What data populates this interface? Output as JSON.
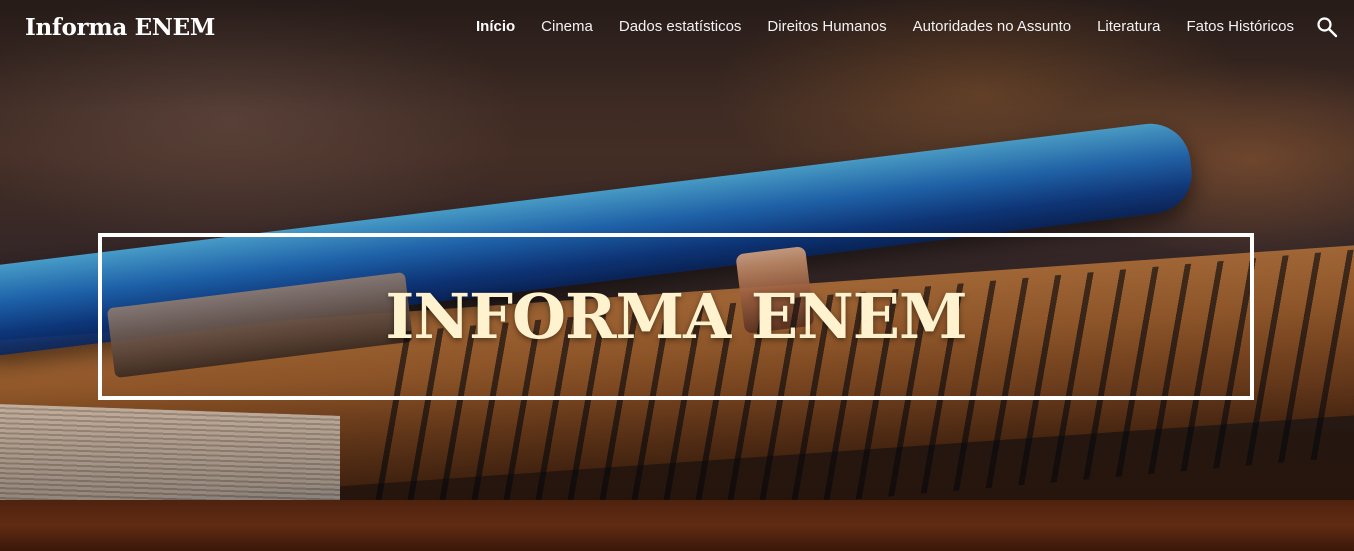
{
  "site": {
    "title": "Informa ENEM"
  },
  "nav": {
    "items": [
      {
        "label": "Início",
        "active": true
      },
      {
        "label": "Cinema",
        "active": false
      },
      {
        "label": "Dados estatísticos",
        "active": false
      },
      {
        "label": "Direitos Humanos",
        "active": false
      },
      {
        "label": "Autoridades no Assunto",
        "active": false
      },
      {
        "label": "Literatura",
        "active": false
      },
      {
        "label": "Fatos Históricos",
        "active": false
      }
    ],
    "search_icon": "search-icon"
  },
  "hero": {
    "title": "INFORMA ENEM",
    "background": "notebook-with-pen-photo"
  },
  "colors": {
    "hero_title": "#fff3cf",
    "header_text": "#ffffff",
    "box_border": "#ffffff"
  }
}
